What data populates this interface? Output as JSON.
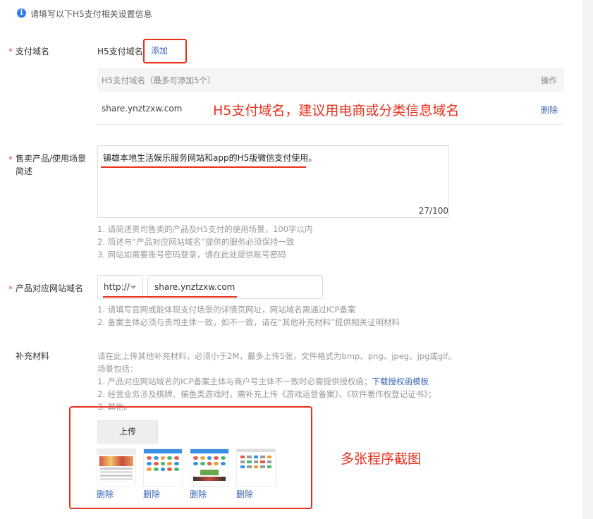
{
  "notice": {
    "text": "请填写以下H5支付相关设置信息"
  },
  "domain_section": {
    "required_mark": "*",
    "label": "支付域名",
    "sub_label": "H5支付域名",
    "add_link": "添加",
    "table": {
      "header_domain": "H5支付域名（最多可添加5个）",
      "header_action": "操作",
      "rows": [
        {
          "domain": "share.ynztzxw.com",
          "action": "删除"
        }
      ]
    },
    "annotation": "H5支付域名，建议用电商或分类信息域名"
  },
  "product_section": {
    "required_mark": "*",
    "label_line1": "售卖产品/使用场景",
    "label_line2": "简述",
    "textarea_value": "镇雄本地生活娱乐服务网站和app的H5版微信支付使用。",
    "counter": "27/100",
    "hints": [
      "1. 请简述贵司售卖的产品及H5支付的使用场景，100字以内",
      "2. 简述与“产品对应网站域名”提供的服务必须保持一致",
      "3. 网站如需要账号密码登录，请在此处提供账号密码"
    ]
  },
  "site_section": {
    "required_mark": "*",
    "label": "产品对应网站域名",
    "protocol_value": "http://",
    "domain_value": "share.ynztzxw.com",
    "hints": [
      "1. 请填写官网或能体现支付场景的详情页网址，网站域名需通过ICP备案",
      "2. 备案主体必须与贵司主体一致，如不一致，请在“其他补充材料”提供相关证明材料"
    ]
  },
  "material_section": {
    "label": "补充材料",
    "desc": "请在此上传其他补充材料，必须小于2M，最多上传5张，文件格式为bmp、png、jpeg、jpg或gif。",
    "scene_title": "场景包括：",
    "line1": "1. 产品对应网站域名的ICP备案主体与商户号主体不一致时必需提供授权函；",
    "line1_link": "下载授权函模板",
    "line2": "2. 经营业务涉及棋牌、捕鱼类游戏时，需补充上传《游戏运营备案》、《软件著作权登记证书》；",
    "line3": "3. 其他。",
    "upload_label": "上传",
    "thumbnails": [
      {
        "delete_label": "删除"
      },
      {
        "delete_label": "删除"
      },
      {
        "delete_label": "删除"
      },
      {
        "delete_label": "删除"
      }
    ],
    "annotation": "多张程序截图"
  },
  "colors": {
    "link": "#3a67b5",
    "annotation_red": "#e8301c",
    "required_star": "#e84e4e",
    "info_blue": "#2f7ce8"
  }
}
